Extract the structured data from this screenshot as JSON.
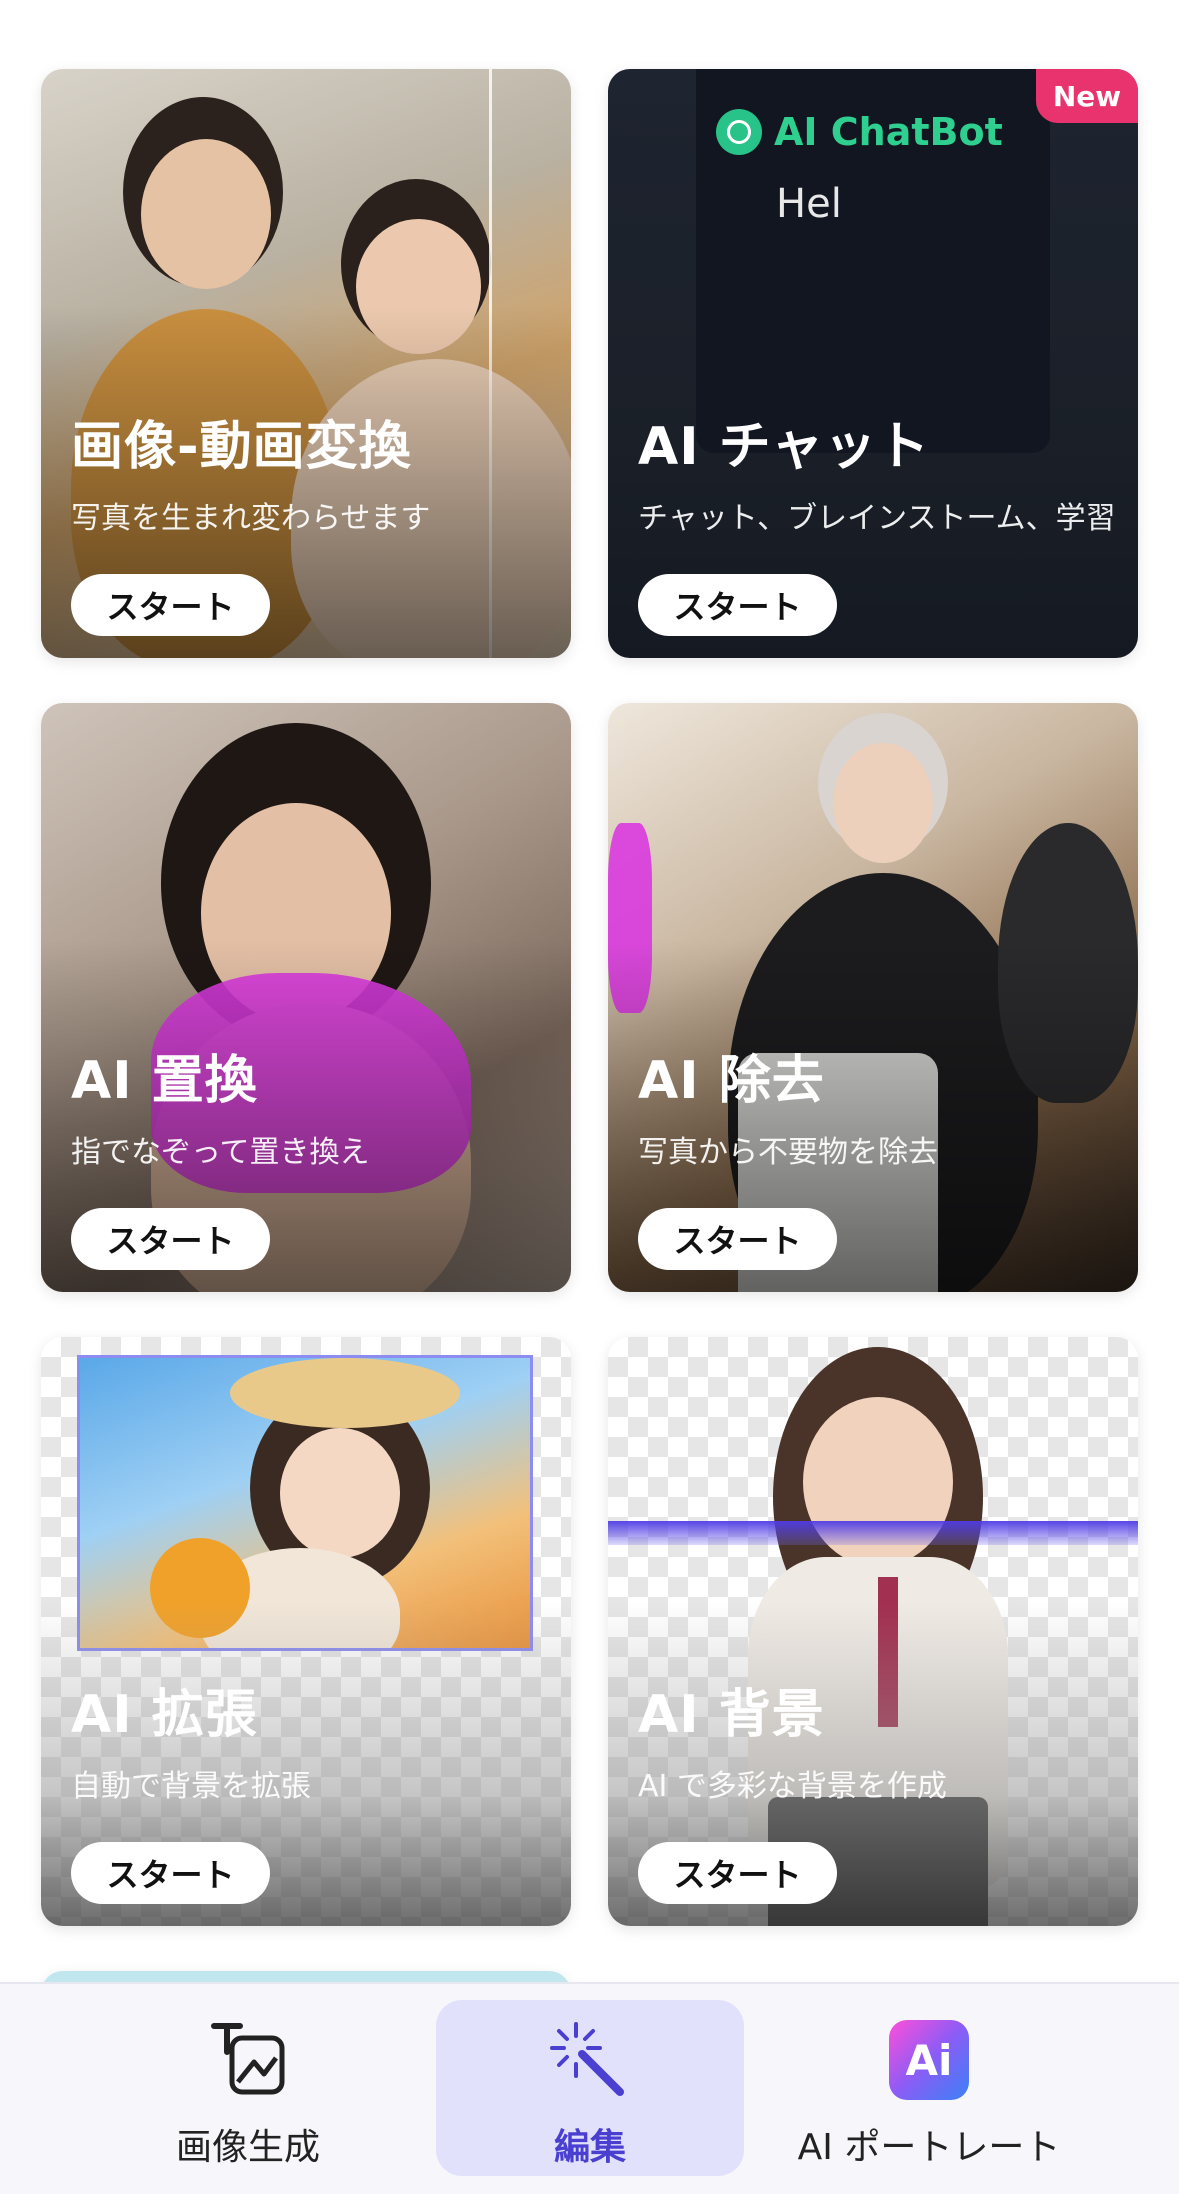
{
  "cards": [
    {
      "title": "画像-動画変換",
      "subtitle": "写真を生まれ変わらせます",
      "button": "スタート"
    },
    {
      "title": "AI チャット",
      "subtitle": "チャット、ブレインストーム、学習",
      "button": "スタート",
      "badge": "New",
      "preview": {
        "brand": "AI ChatBot",
        "text": "Hel"
      }
    },
    {
      "title": "AI 置換",
      "subtitle": "指でなぞって置き換え",
      "button": "スタート"
    },
    {
      "title": "AI 除去",
      "subtitle": "写真から不要物を除去",
      "button": "スタート"
    },
    {
      "title": "AI 拡張",
      "subtitle": "自動で背景を拡張",
      "button": "スタート"
    },
    {
      "title": "AI 背景",
      "subtitle": "AI で多彩な背景を作成",
      "button": "スタート"
    }
  ],
  "nav": {
    "items": [
      {
        "label": "画像生成",
        "icon": "image-generate-icon",
        "active": false
      },
      {
        "label": "編集",
        "icon": "magic-wand-icon",
        "active": true
      },
      {
        "label": "AI ポートレート",
        "icon": "ai-portrait-icon",
        "active": false,
        "tile_text": "Ai"
      }
    ]
  },
  "colors": {
    "accent": "#4a3fd1",
    "badge": "#e8336e",
    "chatbot_green": "#2fd08f"
  }
}
